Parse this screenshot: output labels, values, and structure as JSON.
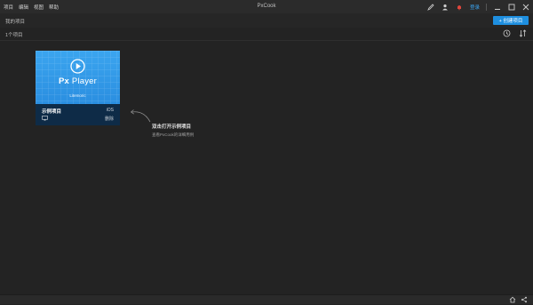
{
  "menu": [
    "项目",
    "编辑",
    "视图",
    "帮助"
  ],
  "app_title": "PxCook",
  "titlebar": {
    "login_label": "登录"
  },
  "breadcrumb": "我的项目",
  "create_button_label": "+ 创建项目",
  "project_count": "1个项目",
  "card": {
    "brand_px": "Px",
    "brand_name": " Player",
    "brand_sub": "Litemoric",
    "name": "示例项目",
    "platform": "iOS",
    "delete_label": "删除"
  },
  "hint": {
    "title": "双击打开示例项目",
    "subtitle": "查看PxCook的详细用例"
  },
  "colors": {
    "accent": "#1e8fe0",
    "card_blue": "#3ba5ef",
    "background": "#232323"
  }
}
